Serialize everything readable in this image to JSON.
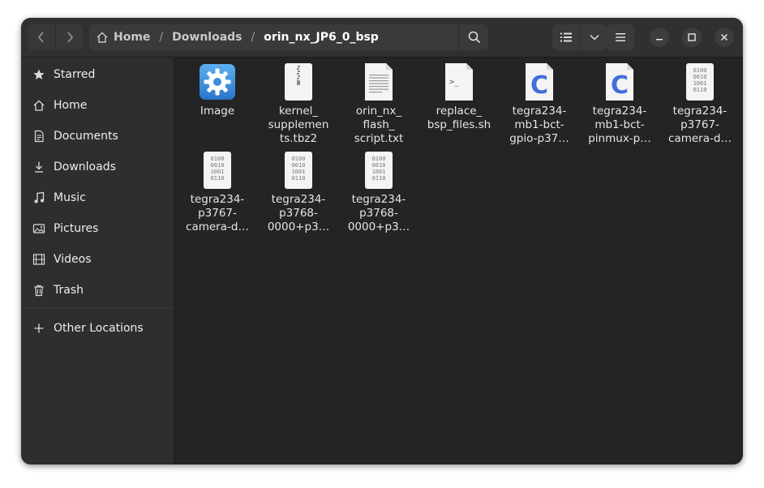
{
  "breadcrumb": {
    "home": "Home",
    "downloads": "Downloads",
    "current": "orin_nx_JP6_0_bsp",
    "separator": "/"
  },
  "sidebar": {
    "items": [
      {
        "label": "Starred",
        "icon": "star-icon"
      },
      {
        "label": "Home",
        "icon": "home-icon"
      },
      {
        "label": "Documents",
        "icon": "document-icon"
      },
      {
        "label": "Downloads",
        "icon": "download-icon"
      },
      {
        "label": "Music",
        "icon": "music-icon"
      },
      {
        "label": "Pictures",
        "icon": "picture-icon"
      },
      {
        "label": "Videos",
        "icon": "video-icon"
      },
      {
        "label": "Trash",
        "icon": "trash-icon"
      }
    ],
    "other_locations": "Other Locations"
  },
  "files": [
    {
      "name": "Image",
      "type": "executable"
    },
    {
      "name": "kernel_\nsupplemen\nts.tbz2",
      "type": "archive"
    },
    {
      "name": "orin_nx_\nflash_\nscript.txt",
      "type": "text"
    },
    {
      "name": "replace_\nbsp_files.sh",
      "type": "script"
    },
    {
      "name": "tegra234-\nmb1-bct-\ngpio-p37…",
      "type": "c-source"
    },
    {
      "name": "tegra234-\nmb1-bct-\npinmux-p…",
      "type": "c-source"
    },
    {
      "name": "tegra234-\np3767-\ncamera-d…",
      "type": "binary"
    },
    {
      "name": "tegra234-\np3767-\ncamera-d…",
      "type": "binary"
    },
    {
      "name": "tegra234-\np3768-\n0000+p3…",
      "type": "binary"
    },
    {
      "name": "tegra234-\np3768-\n0000+p3…",
      "type": "binary"
    }
  ],
  "binary_icon_text": [
    "0100",
    "0010",
    "1001",
    "0110"
  ],
  "c_icon_letter": "C",
  "script_icon_text": ">_",
  "colors": {
    "window_bg": "#242424",
    "header_bg": "#303030",
    "sidebar_bg": "#2e2e2e",
    "c_icon_blue": "#3f6fd8",
    "exec_icon_blue": "#3a8ee0"
  }
}
